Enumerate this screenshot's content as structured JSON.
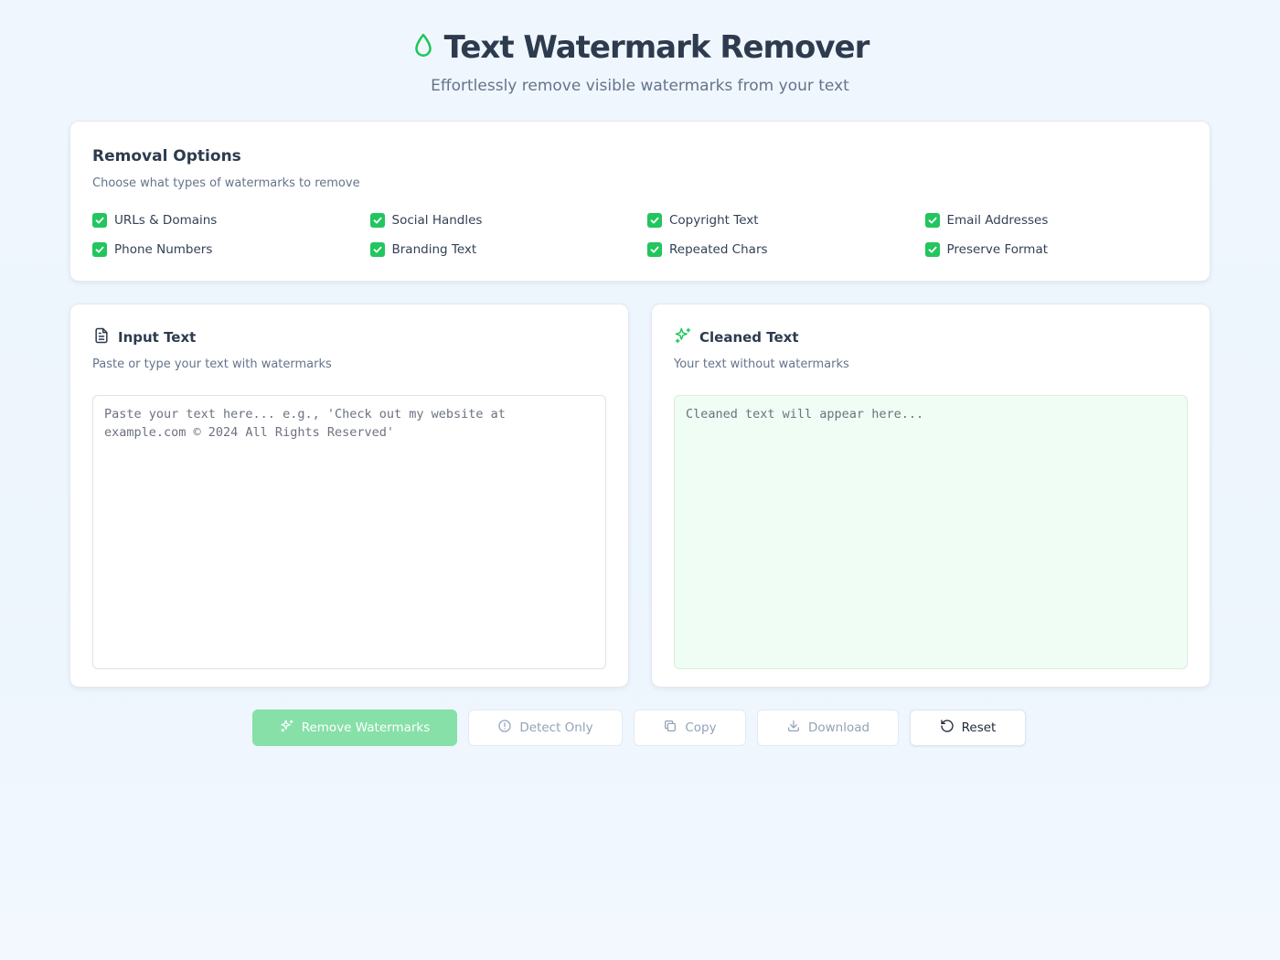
{
  "header": {
    "title": "Text Watermark Remover",
    "subtitle": "Effortlessly remove visible watermarks from your text"
  },
  "options": {
    "title": "Removal Options",
    "description": "Choose what types of watermarks to remove",
    "items": [
      {
        "label": "URLs & Domains",
        "checked": true
      },
      {
        "label": "Social Handles",
        "checked": true
      },
      {
        "label": "Copyright Text",
        "checked": true
      },
      {
        "label": "Email Addresses",
        "checked": true
      },
      {
        "label": "Phone Numbers",
        "checked": true
      },
      {
        "label": "Branding Text",
        "checked": true
      },
      {
        "label": "Repeated Chars",
        "checked": true
      },
      {
        "label": "Preserve Format",
        "checked": true
      }
    ]
  },
  "input": {
    "title": "Input Text",
    "description": "Paste or type your text with watermarks",
    "placeholder": "Paste your text here... e.g., 'Check out my website at example.com © 2024 All Rights Reserved'",
    "value": ""
  },
  "output": {
    "title": "Cleaned Text",
    "description": "Your text without watermarks",
    "placeholder": "Cleaned text will appear here...",
    "value": ""
  },
  "actions": {
    "remove_label": "Remove Watermarks",
    "detect_label": "Detect Only",
    "copy_label": "Copy",
    "download_label": "Download",
    "reset_label": "Reset"
  },
  "colors": {
    "accent": "#22c55e",
    "primary_disabled": "#86e0a8",
    "output_bg": "#f0fdf4"
  }
}
